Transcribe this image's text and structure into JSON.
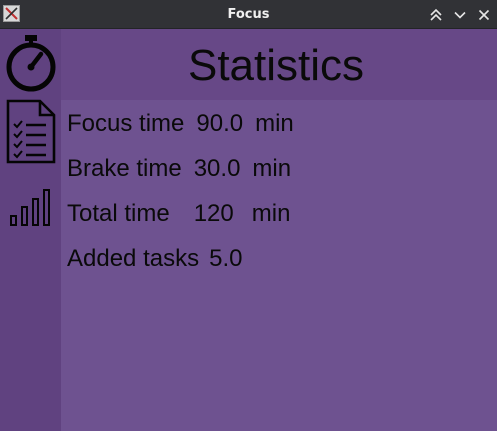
{
  "window": {
    "title": "Focus",
    "controls": [
      "keep-above-icon",
      "minimize-icon",
      "close-icon"
    ]
  },
  "sidebar": {
    "items": [
      {
        "name": "timer",
        "icon": "stopwatch-icon"
      },
      {
        "name": "tasks",
        "icon": "checklist-icon",
        "selected": true
      },
      {
        "name": "statistics",
        "icon": "bar-chart-icon"
      }
    ]
  },
  "page": {
    "title": "Statistics"
  },
  "stats": {
    "focus": {
      "label": "Focus time",
      "value": "90.0",
      "unit": "min"
    },
    "brake": {
      "label": "Brake time",
      "value": "30.0",
      "unit": "min"
    },
    "total": {
      "label": "Total time",
      "value": "120",
      "unit": "min"
    },
    "tasks": {
      "label": "Added tasks",
      "value": "5.0"
    }
  },
  "colors": {
    "background": "#6a4a8a",
    "sidebar": "#604280",
    "content": "#6e5290",
    "text": "#0a0a0a",
    "titlebar": "#313236"
  }
}
